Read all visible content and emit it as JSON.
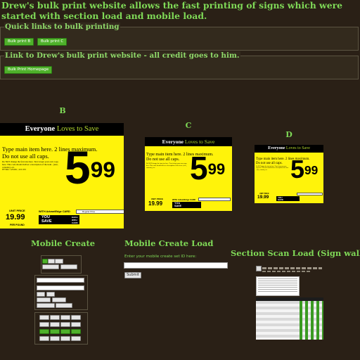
{
  "headline": "Drew's bulk print website allows the fast printing of signs which were started with section load and mobile load.",
  "quick_links": {
    "legend": "Quick links to bulk printing",
    "buttons": [
      "Bulk print B",
      "Bulk print C"
    ]
  },
  "drew_link": {
    "legend": "Link to Drew's bulk print website - all credit goes to him.",
    "button": "Bulk Print Homepage"
  },
  "signs": [
    {
      "letter": "B"
    },
    {
      "letter": "C"
    },
    {
      "letter": "D"
    }
  ],
  "sign_content": {
    "everyone": "Everyone",
    "loves_to_save": "Loves to Save",
    "main_text_1": "Type main item here. 2 lines maximum.",
    "main_text_2": "Do not use all caps.",
    "fine_print": "Do NOT change the font size here. Text is kept your own copy here. This code should deliver a description of the item - (size, contents), etc.",
    "sku": "PP SKU 123456 | 123-333",
    "price_dollars": "5",
    "price_cents": "99",
    "unit_price_label": "UNIT PRICE",
    "unit_price": "19.99",
    "per_pound": "PER POUND",
    "with_card": "WITH AdvantEdge CARD",
    "regular_price": "Regular Price",
    "you_save": "YOU SAVE",
    "each": "EACH",
    "with": "WITH",
    "card": "CARD"
  },
  "mobile_create": {
    "title": "Mobile Create"
  },
  "mobile_create_load": {
    "title": "Mobile Create Load",
    "prompt": "Enter your mobile create set ID here:",
    "input_value": "",
    "submit": "Submit"
  },
  "section_scan": {
    "title": "Section Scan Load (Sign walk)"
  }
}
